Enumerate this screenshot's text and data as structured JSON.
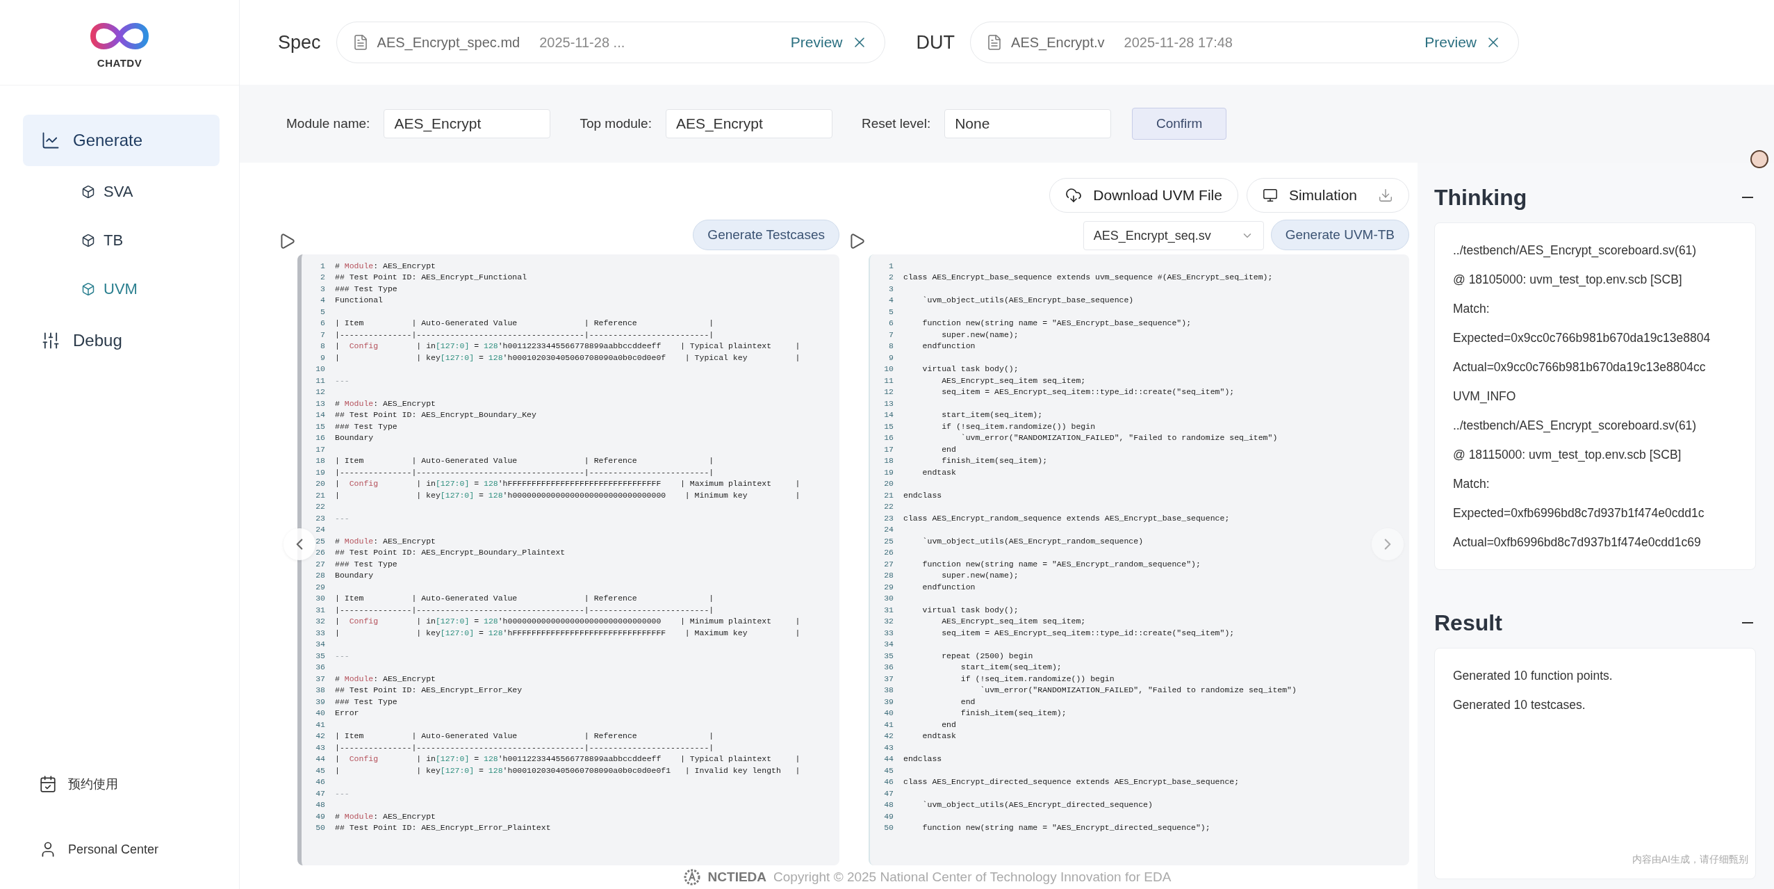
{
  "sidebar": {
    "logo_text": "CHATDV",
    "items": [
      {
        "label": "Generate",
        "selected": true,
        "children": [
          {
            "label": "SVA",
            "selected": false
          },
          {
            "label": "TB",
            "selected": false
          },
          {
            "label": "UVM",
            "selected": true
          }
        ]
      },
      {
        "label": "Debug",
        "selected": false
      }
    ],
    "bottom": [
      "预约使用",
      "Personal Center"
    ]
  },
  "header": {
    "files": [
      {
        "label": "Spec",
        "name": "AES_Encrypt_spec.md",
        "date": "2025-11-28 ...",
        "action": "Preview"
      },
      {
        "label": "DUT",
        "name": "AES_Encrypt.v",
        "date": "2025-11-28 17:48",
        "action": "Preview"
      }
    ]
  },
  "form": {
    "fields": [
      {
        "label": "Module name:",
        "value": "AES_Encrypt"
      },
      {
        "label": "Top module:",
        "value": "AES_Encrypt"
      },
      {
        "label": "Reset level:",
        "value": "None"
      }
    ],
    "confirm": "Confirm"
  },
  "toolbar": {
    "download": "Download UVM File",
    "simulation": "Simulation"
  },
  "panels": [
    {
      "button": "Generate Testcases",
      "lines": [
        {
          "n": "1",
          "parts": [
            {
              "text": "# ",
              "kind": "plain"
            },
            {
              "text": "Module",
              "kind": "key"
            },
            {
              "text": ": AES_Encrypt",
              "kind": "plain"
            }
          ]
        },
        {
          "n": "2",
          "text": "## Test Point ID: AES_Encrypt_Functional"
        },
        {
          "n": "3",
          "text": "### Test Type"
        },
        {
          "n": "4",
          "text": "Functional"
        },
        {
          "n": "5"
        },
        {
          "n": "6",
          "text": "| Item          | Auto-Generated Value              | Reference               |"
        },
        {
          "n": "7",
          "text": "|---------------|-----------------------------------|-------------------------|"
        },
        {
          "n": "8",
          "parts": [
            {
              "text": "|  ",
              "kind": "plain"
            },
            {
              "text": "Config",
              "kind": "key"
            },
            {
              "text": "        | in",
              "kind": "plain"
            },
            {
              "text": "[127:0]",
              "kind": "num"
            },
            {
              "text": " = ",
              "kind": "plain"
            },
            {
              "text": "128",
              "kind": "num"
            },
            {
              "text": "'h00112233445566778899aabbccddeeff    | Typical plaintext     |",
              "kind": "plain"
            }
          ]
        },
        {
          "n": "9",
          "parts": [
            {
              "text": "|                | key",
              "kind": "plain"
            },
            {
              "text": "[127:0]",
              "kind": "num"
            },
            {
              "text": " = ",
              "kind": "plain"
            },
            {
              "text": "128",
              "kind": "num"
            },
            {
              "text": "'h000102030405060708090a0b0c0d0e0f    | Typical key          |",
              "kind": "plain"
            }
          ]
        },
        {
          "n": "10"
        },
        {
          "n": "11",
          "parts": [
            {
              "text": "---",
              "kind": "dim"
            }
          ]
        },
        {
          "n": "12"
        },
        {
          "n": "13",
          "parts": [
            {
              "text": "# ",
              "kind": "plain"
            },
            {
              "text": "Module",
              "kind": "key"
            },
            {
              "text": ": AES_Encrypt",
              "kind": "plain"
            }
          ]
        },
        {
          "n": "14",
          "text": "## Test Point ID: AES_Encrypt_Boundary_Key"
        },
        {
          "n": "15",
          "text": "### Test Type"
        },
        {
          "n": "16",
          "text": "Boundary"
        },
        {
          "n": "17"
        },
        {
          "n": "18",
          "text": "| Item          | Auto-Generated Value              | Reference               |"
        },
        {
          "n": "19",
          "text": "|---------------|-----------------------------------|-------------------------|"
        },
        {
          "n": "20",
          "parts": [
            {
              "text": "|  ",
              "kind": "plain"
            },
            {
              "text": "Config",
              "kind": "key"
            },
            {
              "text": "        | in",
              "kind": "plain"
            },
            {
              "text": "[127:0]",
              "kind": "num"
            },
            {
              "text": " = ",
              "kind": "plain"
            },
            {
              "text": "128",
              "kind": "num"
            },
            {
              "text": "'hFFFFFFFFFFFFFFFFFFFFFFFFFFFFFFFF    | Maximum plaintext     |",
              "kind": "plain"
            }
          ]
        },
        {
          "n": "21",
          "parts": [
            {
              "text": "|                | key",
              "kind": "plain"
            },
            {
              "text": "[127:0]",
              "kind": "num"
            },
            {
              "text": " = ",
              "kind": "plain"
            },
            {
              "text": "128",
              "kind": "num"
            },
            {
              "text": "'h00000000000000000000000000000000    | Minimum key          |",
              "kind": "plain"
            }
          ]
        },
        {
          "n": "22"
        },
        {
          "n": "23",
          "parts": [
            {
              "text": "---",
              "kind": "dim"
            }
          ]
        },
        {
          "n": "24"
        },
        {
          "n": "25",
          "parts": [
            {
              "text": "# ",
              "kind": "plain"
            },
            {
              "text": "Module",
              "kind": "key"
            },
            {
              "text": ": AES_Encrypt",
              "kind": "plain"
            }
          ]
        },
        {
          "n": "26",
          "text": "## Test Point ID: AES_Encrypt_Boundary_Plaintext"
        },
        {
          "n": "27",
          "text": "### Test Type"
        },
        {
          "n": "28",
          "text": "Boundary"
        },
        {
          "n": "29"
        },
        {
          "n": "30",
          "text": "| Item          | Auto-Generated Value              | Reference               |"
        },
        {
          "n": "31",
          "text": "|---------------|-----------------------------------|-------------------------|"
        },
        {
          "n": "32",
          "parts": [
            {
              "text": "|  ",
              "kind": "plain"
            },
            {
              "text": "Config",
              "kind": "key"
            },
            {
              "text": "        | in",
              "kind": "plain"
            },
            {
              "text": "[127:0]",
              "kind": "num"
            },
            {
              "text": " = ",
              "kind": "plain"
            },
            {
              "text": "128",
              "kind": "num"
            },
            {
              "text": "'h00000000000000000000000000000000    | Minimum plaintext     |",
              "kind": "plain"
            }
          ]
        },
        {
          "n": "33",
          "parts": [
            {
              "text": "|                | key",
              "kind": "plain"
            },
            {
              "text": "[127:0]",
              "kind": "num"
            },
            {
              "text": " = ",
              "kind": "plain"
            },
            {
              "text": "128",
              "kind": "num"
            },
            {
              "text": "'hFFFFFFFFFFFFFFFFFFFFFFFFFFFFFFFF    | Maximum key          |",
              "kind": "plain"
            }
          ]
        },
        {
          "n": "34"
        },
        {
          "n": "35",
          "parts": [
            {
              "text": "---",
              "kind": "dim"
            }
          ]
        },
        {
          "n": "36"
        },
        {
          "n": "37",
          "parts": [
            {
              "text": "# ",
              "kind": "plain"
            },
            {
              "text": "Module",
              "kind": "key"
            },
            {
              "text": ": AES_Encrypt",
              "kind": "plain"
            }
          ]
        },
        {
          "n": "38",
          "text": "## Test Point ID: AES_Encrypt_Error_Key"
        },
        {
          "n": "39",
          "text": "### Test Type"
        },
        {
          "n": "40",
          "text": "Error"
        },
        {
          "n": "41"
        },
        {
          "n": "42",
          "text": "| Item          | Auto-Generated Value              | Reference               |"
        },
        {
          "n": "43",
          "text": "|---------------|-----------------------------------|-------------------------|"
        },
        {
          "n": "44",
          "parts": [
            {
              "text": "|  ",
              "kind": "plain"
            },
            {
              "text": "Config",
              "kind": "key"
            },
            {
              "text": "        | in",
              "kind": "plain"
            },
            {
              "text": "[127:0]",
              "kind": "num"
            },
            {
              "text": " = ",
              "kind": "plain"
            },
            {
              "text": "128",
              "kind": "num"
            },
            {
              "text": "'h00112233445566778899aabbccddeeff    | Typical plaintext     |",
              "kind": "plain"
            }
          ]
        },
        {
          "n": "45",
          "parts": [
            {
              "text": "|                | key",
              "kind": "plain"
            },
            {
              "text": "[127:0]",
              "kind": "num"
            },
            {
              "text": " = ",
              "kind": "plain"
            },
            {
              "text": "128",
              "kind": "num"
            },
            {
              "text": "'h000102030405060708090a0b0c0d0e0f1   | Invalid key length   |",
              "kind": "plain"
            }
          ]
        },
        {
          "n": "46"
        },
        {
          "n": "47",
          "parts": [
            {
              "text": "---",
              "kind": "dim"
            }
          ]
        },
        {
          "n": "48"
        },
        {
          "n": "49",
          "parts": [
            {
              "text": "# ",
              "kind": "plain"
            },
            {
              "text": "Module",
              "kind": "key"
            },
            {
              "text": ": AES_Encrypt",
              "kind": "plain"
            }
          ]
        },
        {
          "n": "50",
          "text": "## Test Point ID: AES_Encrypt_Error_Plaintext"
        }
      ]
    },
    {
      "file_select": "AES_Encrypt_seq.sv",
      "button": "Generate UVM-TB",
      "lines": [
        {
          "n": "1"
        },
        {
          "n": "2",
          "text": "class AES_Encrypt_base_sequence extends uvm_sequence #(AES_Encrypt_seq_item);"
        },
        {
          "n": "3"
        },
        {
          "n": "4",
          "text": "    `uvm_object_utils(AES_Encrypt_base_sequence)"
        },
        {
          "n": "5"
        },
        {
          "n": "6",
          "text": "    function new(string name = \"AES_Encrypt_base_sequence\");"
        },
        {
          "n": "7",
          "text": "        super.new(name);"
        },
        {
          "n": "8",
          "text": "    endfunction"
        },
        {
          "n": "9"
        },
        {
          "n": "10",
          "text": "    virtual task body();"
        },
        {
          "n": "11",
          "text": "        AES_Encrypt_seq_item seq_item;"
        },
        {
          "n": "12",
          "text": "        seq_item = AES_Encrypt_seq_item::type_id::create(\"seq_item\");"
        },
        {
          "n": "13"
        },
        {
          "n": "14",
          "text": "        start_item(seq_item);"
        },
        {
          "n": "15",
          "text": "        if (!seq_item.randomize()) begin"
        },
        {
          "n": "16",
          "text": "            `uvm_error(\"RANDOMIZATION_FAILED\", \"Failed to randomize seq_item\")"
        },
        {
          "n": "17",
          "text": "        end"
        },
        {
          "n": "18",
          "text": "        finish_item(seq_item);"
        },
        {
          "n": "19",
          "text": "    endtask"
        },
        {
          "n": "20"
        },
        {
          "n": "21",
          "text": "endclass"
        },
        {
          "n": "22"
        },
        {
          "n": "23",
          "text": "class AES_Encrypt_random_sequence extends AES_Encrypt_base_sequence;"
        },
        {
          "n": "24"
        },
        {
          "n": "25",
          "text": "    `uvm_object_utils(AES_Encrypt_random_sequence)"
        },
        {
          "n": "26"
        },
        {
          "n": "27",
          "text": "    function new(string name = \"AES_Encrypt_random_sequence\");"
        },
        {
          "n": "28",
          "text": "        super.new(name);"
        },
        {
          "n": "29",
          "text": "    endfunction"
        },
        {
          "n": "30"
        },
        {
          "n": "31",
          "text": "    virtual task body();"
        },
        {
          "n": "32",
          "text": "        AES_Encrypt_seq_item seq_item;"
        },
        {
          "n": "33",
          "text": "        seq_item = AES_Encrypt_seq_item::type_id::create(\"seq_item\");"
        },
        {
          "n": "34"
        },
        {
          "n": "35",
          "text": "        repeat (2500) begin"
        },
        {
          "n": "36",
          "text": "            start_item(seq_item);"
        },
        {
          "n": "37",
          "text": "            if (!seq_item.randomize()) begin"
        },
        {
          "n": "38",
          "text": "                `uvm_error(\"RANDOMIZATION_FAILED\", \"Failed to randomize seq_item\")"
        },
        {
          "n": "39",
          "text": "            end"
        },
        {
          "n": "40",
          "text": "            finish_item(seq_item);"
        },
        {
          "n": "41",
          "text": "        end"
        },
        {
          "n": "42",
          "text": "    endtask"
        },
        {
          "n": "43"
        },
        {
          "n": "44",
          "text": "endclass"
        },
        {
          "n": "45"
        },
        {
          "n": "46",
          "text": "class AES_Encrypt_directed_sequence extends AES_Encrypt_base_sequence;"
        },
        {
          "n": "47"
        },
        {
          "n": "48",
          "text": "    `uvm_object_utils(AES_Encrypt_directed_sequence)"
        },
        {
          "n": "49"
        },
        {
          "n": "50",
          "text": "    function new(string name = \"AES_Encrypt_directed_sequence\");"
        }
      ]
    }
  ],
  "thinking": {
    "title": "Thinking",
    "lines": [
      "../testbench/AES_Encrypt_scoreboard.sv(61)",
      "@ 18105000: uvm_test_top.env.scb [SCB]",
      "Match:",
      "Expected=0x9cc0c766b981b670da19c13e8804",
      "Actual=0x9cc0c766b981b670da19c13e8804cc",
      "UVM_INFO",
      "../testbench/AES_Encrypt_scoreboard.sv(61)",
      "@ 18115000: uvm_test_top.env.scb [SCB]",
      "Match:",
      "Expected=0xfb6996bd8c7d937b1f474e0cdd1c",
      "Actual=0xfb6996bd8c7d937b1f474e0cdd1c69"
    ]
  },
  "result": {
    "title": "Result",
    "lines": [
      "Generated 10 function points.",
      "Generated 10 testcases."
    ],
    "note": "内容由AI生成，请仔细甄别"
  },
  "footer": {
    "brand": "NCTIEDA",
    "copyright": "Copyright © 2025 National Center of Technology Innovation for EDA"
  }
}
